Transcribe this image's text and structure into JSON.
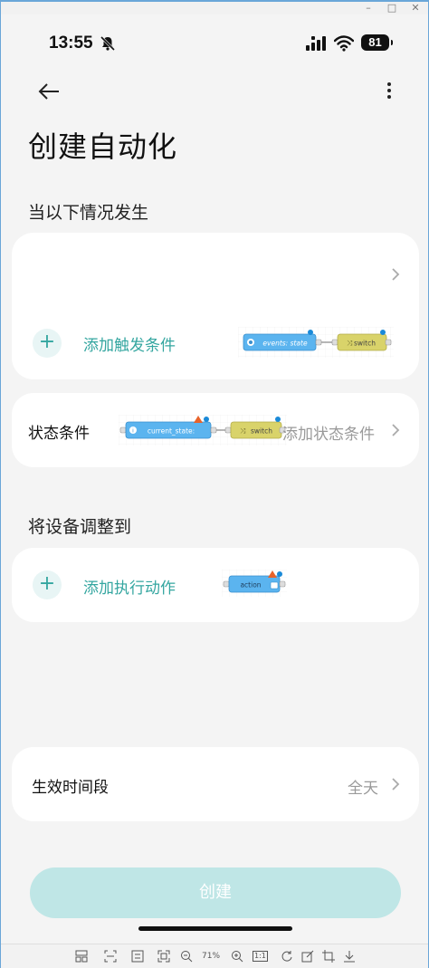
{
  "status_bar": {
    "time": "13:55",
    "battery": "81",
    "icons": [
      "mute-icon",
      "signal-icon",
      "wifi-icon",
      "battery-icon"
    ]
  },
  "header": {
    "back_icon": "arrow-left-icon",
    "more_icon": "more-vertical-icon"
  },
  "page_title": "创建自动化",
  "trigger_section": {
    "title": "当以下情况发生",
    "add_label": "添加触发条件",
    "flow_nodes": [
      "events: state",
      "switch"
    ]
  },
  "condition_section": {
    "label": "状态条件",
    "add_label": "添加状态条件",
    "flow_nodes": [
      "current_state:",
      "switch"
    ]
  },
  "action_section": {
    "title": "将设备调整到",
    "add_label": "添加执行动作",
    "flow_nodes": [
      "action"
    ]
  },
  "schedule": {
    "label": "生效时间段",
    "value": "全天"
  },
  "create_button": "创建",
  "toolbar": {
    "zoom": "71%",
    "ratio": "1:1"
  },
  "colors": {
    "accent": "#34a6a0",
    "button_disabled": "#bfe6e6",
    "node_blue": "#5bb4ef",
    "node_yellow": "#d9d36a"
  }
}
